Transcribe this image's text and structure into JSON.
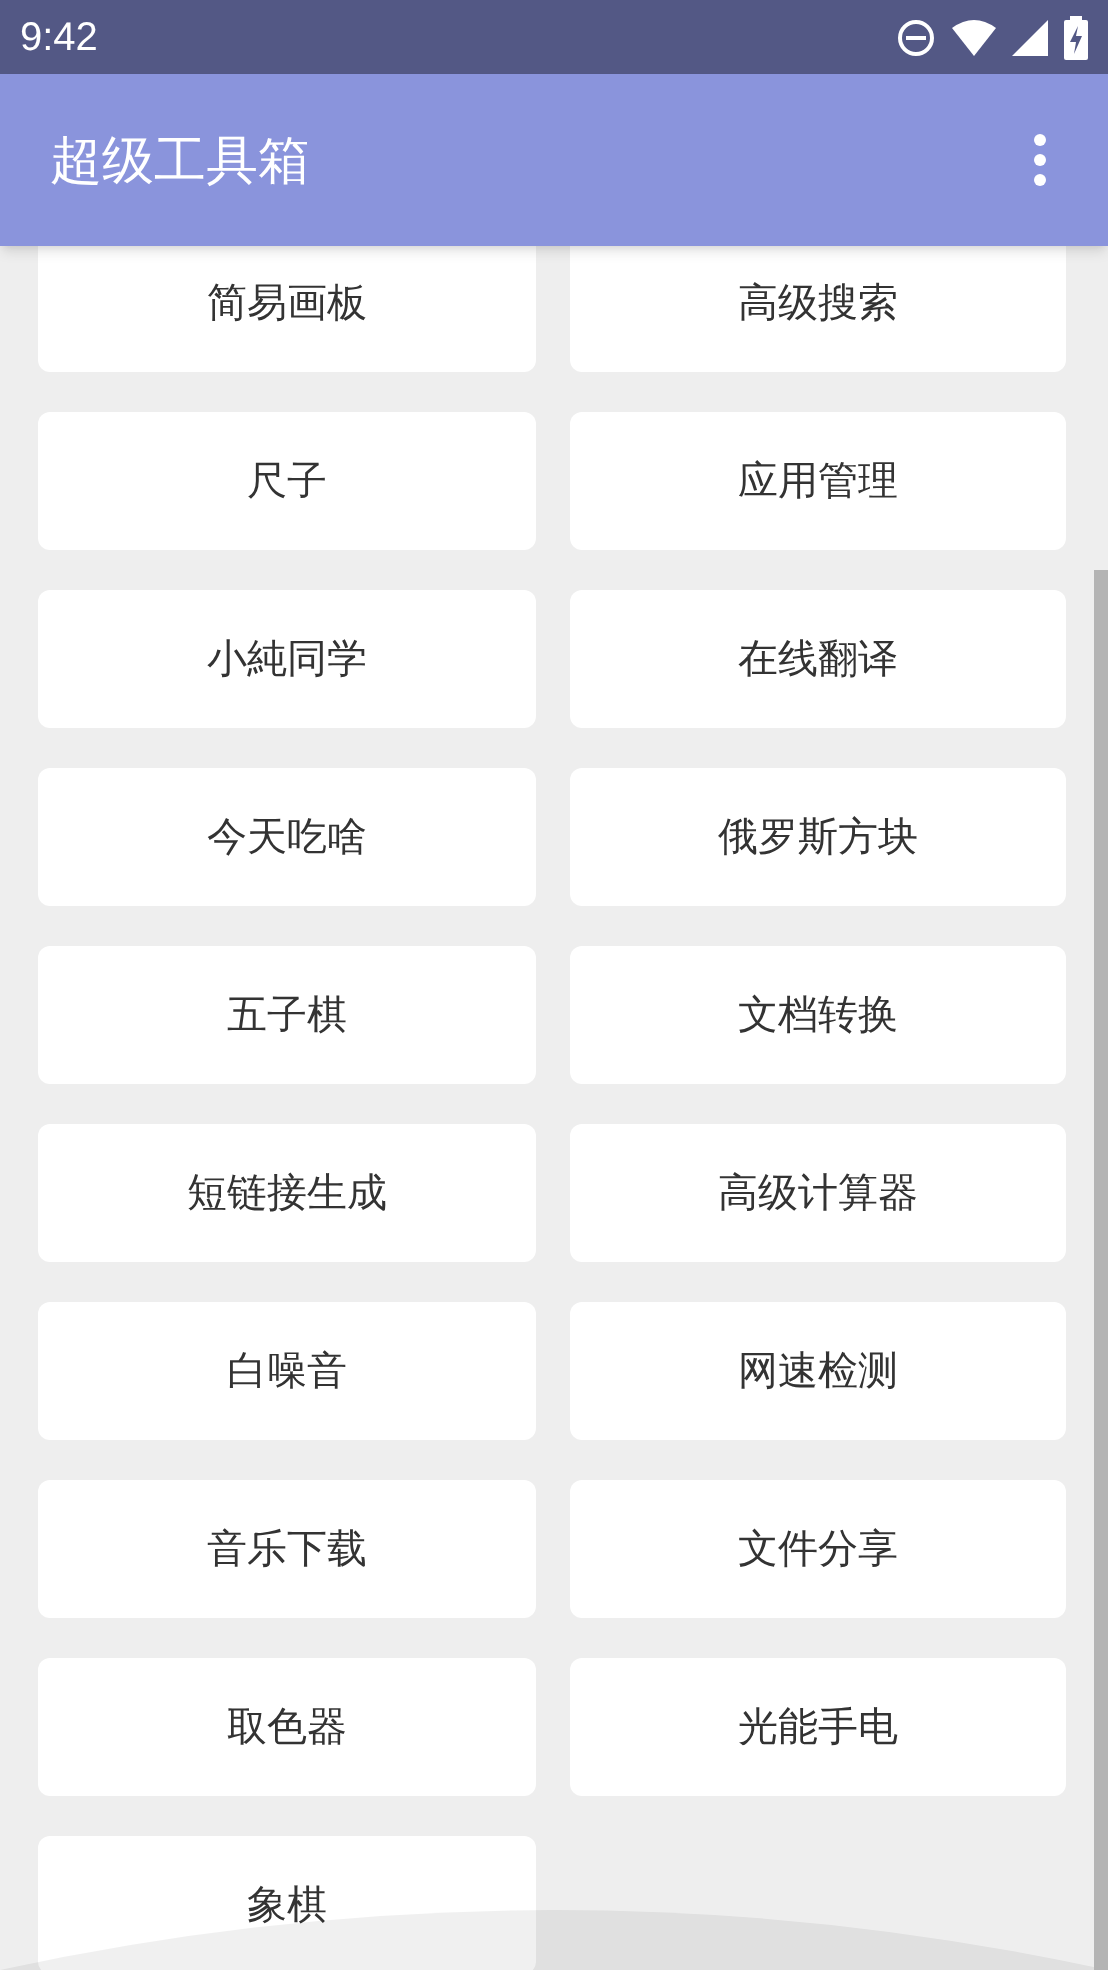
{
  "status_bar": {
    "time": "9:42"
  },
  "app_bar": {
    "title": "超级工具箱"
  },
  "tools": [
    "简易画板",
    "高级搜索",
    "尺子",
    "应用管理",
    "小純同学",
    "在线翻译",
    "今天吃啥",
    "俄罗斯方块",
    "五子棋",
    "文档转换",
    "短链接生成",
    "高级计算器",
    "白噪音",
    "网速检测",
    "音乐下载",
    "文件分享",
    "取色器",
    "光能手电",
    "象棋"
  ]
}
